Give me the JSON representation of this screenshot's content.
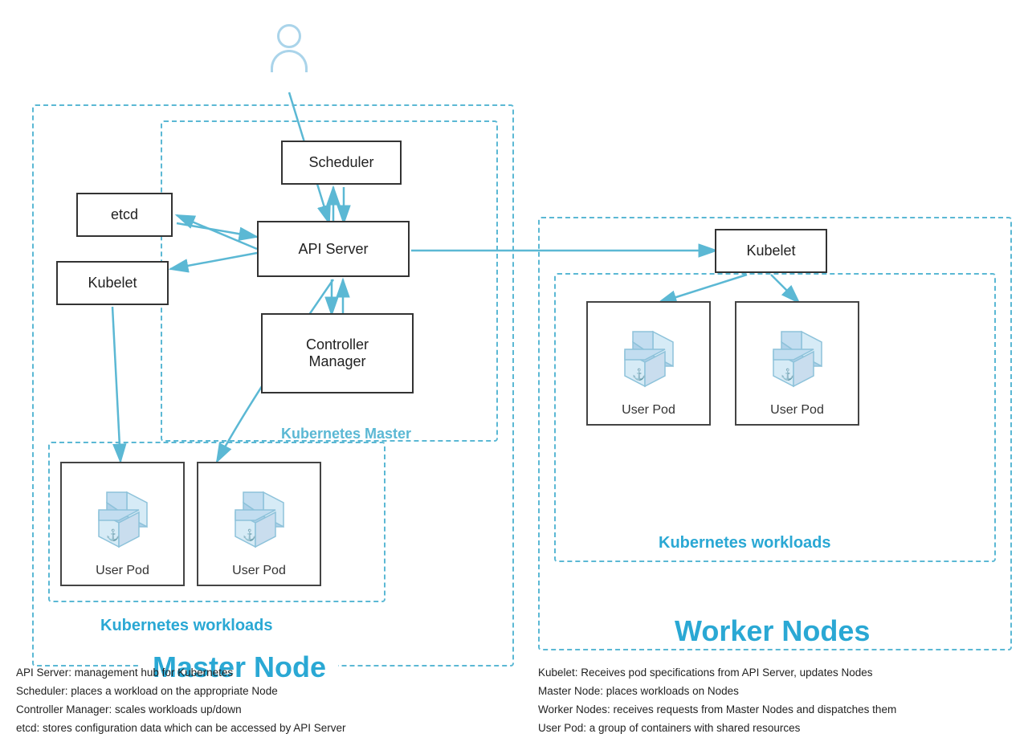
{
  "user_icon": {
    "label": "User"
  },
  "components": {
    "scheduler": "Scheduler",
    "api_server": "API Server",
    "controller_manager": "Controller\nManager",
    "etcd": "etcd",
    "kubelet_master": "Kubelet",
    "kubelet_worker": "Kubelet"
  },
  "labels": {
    "k8s_master": "Kubernetes Master",
    "master_node": "Master Node",
    "worker_nodes": "Worker Nodes",
    "k8s_workloads_master": "Kubernetes workloads",
    "k8s_workloads_worker": "Kubernetes workloads"
  },
  "pods": {
    "user_pod": "User Pod"
  },
  "legend_left": {
    "line1": "API Server: management hub for Kubernetes",
    "line2": "Scheduler: places a workload on the appropriate Node",
    "line3": "Controller Manager: scales workloads up/down",
    "line4": "etcd: stores configuration data which can be accessed by API Server"
  },
  "legend_right": {
    "line1": "Kubelet: Receives pod specifications from API Server, updates Nodes",
    "line2": "Master Node: places workloads on Nodes",
    "line3": "Worker Nodes: receives requests from Master Nodes and dispatches them",
    "line4": "User Pod: a group of containers with shared resources"
  }
}
